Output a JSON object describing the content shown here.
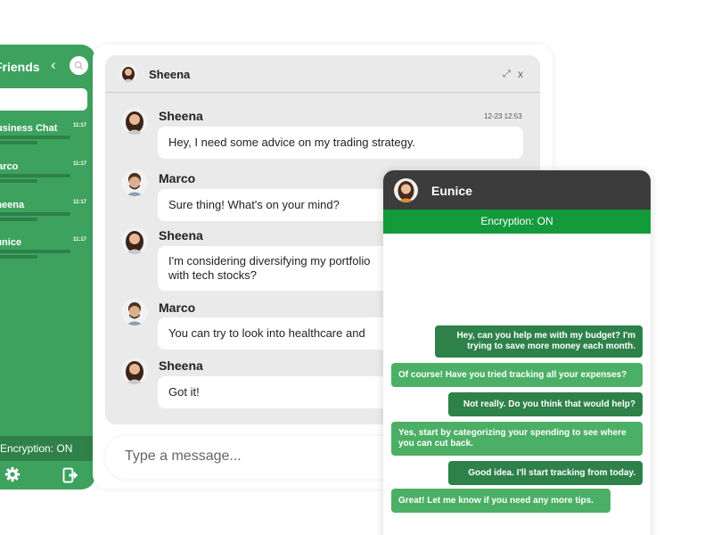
{
  "sidebar": {
    "title": "Friends",
    "items": [
      {
        "name": "Business Chat",
        "time": "11:17"
      },
      {
        "name": "Marco",
        "time": "11:17"
      },
      {
        "name": "Sheena",
        "time": "11:17"
      },
      {
        "name": "Eunice",
        "time": "11:17"
      }
    ],
    "encryption": "Encryption: ON"
  },
  "chat": {
    "header_name": "Sheena",
    "close": "x",
    "timestamp": "12-23 12:53",
    "messages": [
      {
        "sender": "Sheena",
        "text": "Hey, I need some advice on my trading strategy."
      },
      {
        "sender": "Marco",
        "text": "Sure thing! What's on your mind?"
      },
      {
        "sender": "Sheena",
        "text": "I'm considering diversifying my portfolio with tech stocks?"
      },
      {
        "sender": "Marco",
        "text": "You can try to look into healthcare and"
      },
      {
        "sender": "Sheena",
        "text": "Got it!"
      }
    ],
    "input_placeholder": "Type a message..."
  },
  "popup": {
    "name": "Eunice",
    "encryption": "Encryption: ON",
    "messages": [
      {
        "text": "Hey, can you help me with my budget? I'm trying to save more money each month."
      },
      {
        "text": "Of course! Have you tried tracking all your expenses?"
      },
      {
        "text": "Not really. Do you think that would help?"
      },
      {
        "text": "Yes, start by categorizing your spending to see where you can cut back."
      },
      {
        "text": "Good idea. I'll start tracking from today."
      },
      {
        "text": "Great! Let me know if you need any more tips."
      }
    ]
  },
  "colors": {
    "sidebar_green": "#3ea25f",
    "encryption_green": "#139a3b",
    "outgoing_bubble": "#2d8149",
    "incoming_bubble": "#4caf66",
    "popup_header": "#3c3c3c"
  },
  "icons": [
    "chevron-left-icon",
    "search-icon",
    "gear-icon",
    "logout-icon",
    "expand-icon",
    "close-icon"
  ]
}
